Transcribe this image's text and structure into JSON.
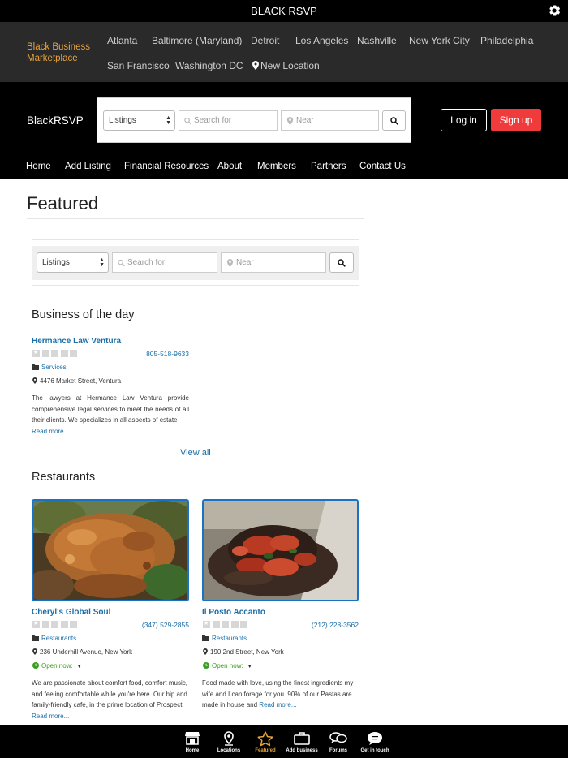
{
  "top_bar": {
    "title": "BLACK RSVP"
  },
  "city_bar": {
    "brand": "Black Business Marketplace",
    "cities": [
      "Atlanta",
      "Baltimore (Maryland)",
      "Detroit",
      "Los Angeles",
      "Nashville",
      "New York City",
      "Philadelphia",
      "San Francisco",
      "Washington DC"
    ],
    "new_location": "New Location"
  },
  "header": {
    "logo": "BlackRSVP",
    "search": {
      "type_value": "Listings",
      "search_placeholder": "Search for",
      "near_placeholder": "Near"
    },
    "login_label": "Log in",
    "signup_label": "Sign up",
    "signup_color": "#ef3b3b"
  },
  "main_nav": [
    "Home",
    "Add Listing",
    "Financial Resources",
    "About",
    "Members",
    "Partners",
    "Contact Us"
  ],
  "page": {
    "title": "Featured",
    "search": {
      "type_value": "Listings",
      "search_placeholder": "Search for",
      "near_placeholder": "Near"
    }
  },
  "business_of_day": {
    "heading": "Business of the day",
    "name": "Hermance Law Ventura",
    "phone": "805-518-9633",
    "category": "Services",
    "address": "4476 Market Street, Ventura",
    "description": "The lawyers at Hermance Law Ventura provide comprehensive legal services to meet the needs of all their clients. We specializes in all aspects of estate",
    "read_more": "Read more...",
    "view_all": "View all"
  },
  "restaurants": {
    "heading": "Restaurants",
    "items": [
      {
        "name": "Cheryl's Global Soul",
        "phone": "(347) 529-2855",
        "category": "Restaurants",
        "address": "236 Underhill Avenue, New York",
        "status": "Open now:",
        "description": "We are passionate about comfort food, comfort music, and feeling comfortable while you're here. Our hip and family-friendly cafe, in the prime location of Prospect",
        "read_more": "Read more..."
      },
      {
        "name": "Il Posto Accanto",
        "phone": "(212) 228-3562",
        "category": "Restaurants",
        "address": "190 2nd Street, New York",
        "status": "Open now:",
        "description": "Food made with love, using the finest ingredients my wife and I can forage for you. 90% of our Pastas are made in house and",
        "read_more": "Read more..."
      }
    ]
  },
  "tab_bar": {
    "tabs": [
      {
        "label": "Home",
        "icon": "store-icon"
      },
      {
        "label": "Locations",
        "icon": "map-pin-icon"
      },
      {
        "label": "Featured",
        "icon": "star-icon",
        "active": true
      },
      {
        "label": "Add business",
        "icon": "briefcase-icon"
      },
      {
        "label": "Forums",
        "icon": "chat-bubbles-icon"
      },
      {
        "label": "Get in touch",
        "icon": "speech-bubble-icon"
      }
    ],
    "active_color": "#e8a33d"
  },
  "colors": {
    "link": "#1a6ea8",
    "brand_gold": "#e8a33d",
    "open_green": "#3a9f1e"
  }
}
